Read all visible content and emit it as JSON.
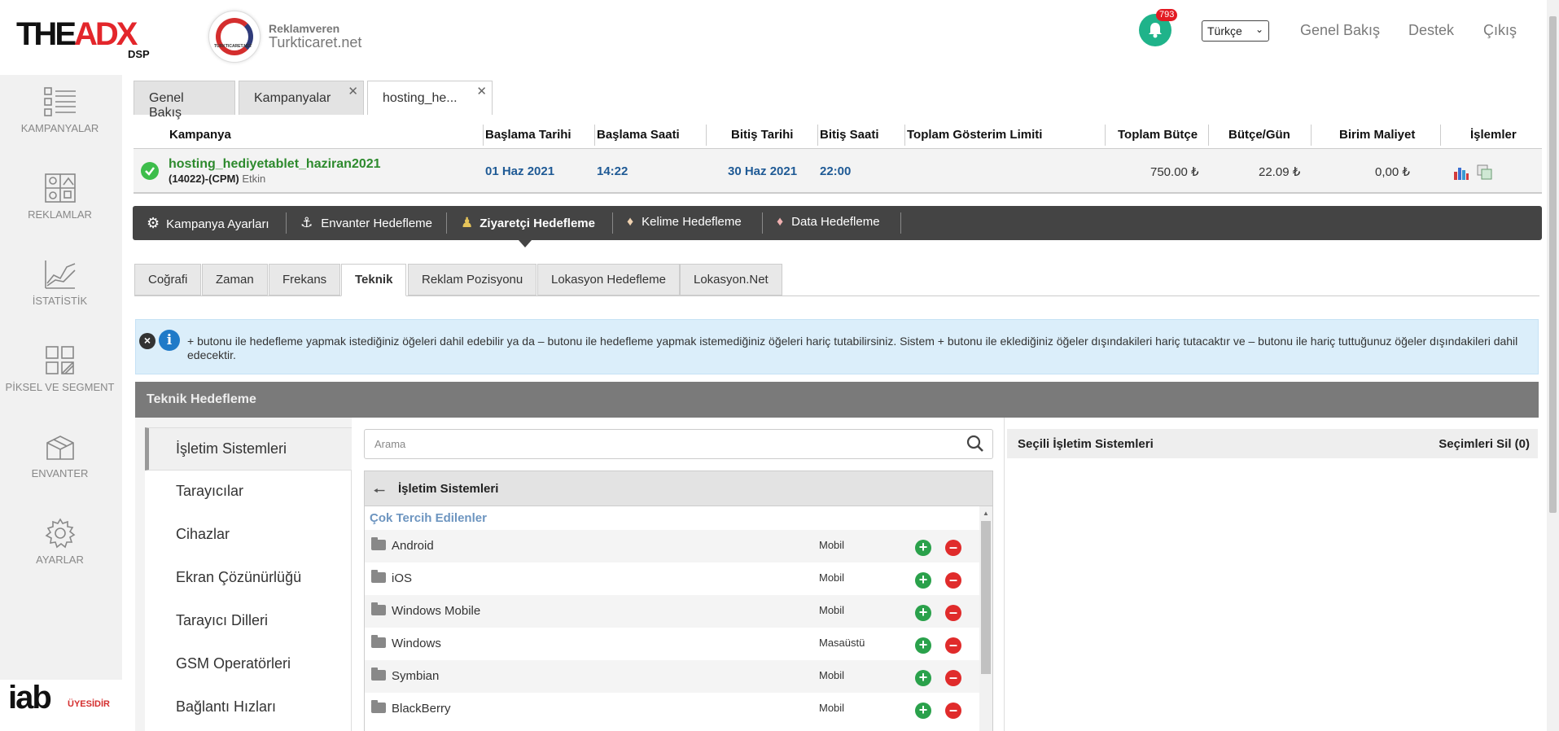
{
  "header": {
    "logo_main": "THE",
    "logo_accent": "ADX",
    "logo_sub": "DSP",
    "advertiser_logo_text": "TURKTICARET.NET",
    "advertiser_label": "Reklamveren",
    "advertiser_name": "Turkticaret.net",
    "notification_count": "793",
    "language": "Türkçe",
    "links": [
      "Genel Bakış",
      "Destek",
      "Çıkış"
    ]
  },
  "sidebar": {
    "items": [
      {
        "label": "KAMPANYALAR",
        "icon": "campaign-list-icon"
      },
      {
        "label": "REKLAMLAR",
        "icon": "ads-icon"
      },
      {
        "label": "İSTATİSTİK",
        "icon": "chart-icon"
      },
      {
        "label": "PİKSEL VE SEGMENT",
        "icon": "segment-icon"
      },
      {
        "label": "ENVANTER",
        "icon": "inventory-box-icon"
      },
      {
        "label": "AYARLAR",
        "icon": "gear-icon"
      }
    ],
    "iab_text": "iab",
    "iab_badge": "ÜYESİDİR"
  },
  "top_tabs": [
    {
      "label": "Genel Bakış",
      "closable": false
    },
    {
      "label": "Kampanyalar",
      "closable": true
    },
    {
      "label": "hosting_he...",
      "closable": true,
      "active": true
    }
  ],
  "campaign_table": {
    "headers": [
      "Kampanya",
      "Başlama Tarihi",
      "Başlama Saati",
      "Bitiş Tarihi",
      "Bitiş Saati",
      "Toplam Gösterim Limiti",
      "Toplam Bütçe",
      "Bütçe/Gün",
      "Birim Maliyet",
      "İşlemler"
    ],
    "row": {
      "name": "hosting_hediyetablet_haziran2021",
      "id_type": "(14022)-(CPM)",
      "status": "Etkin",
      "start_date": "01 Haz 2021",
      "start_time": "14:22",
      "end_date": "30 Haz 2021",
      "end_time": "22:00",
      "impression_limit": "",
      "total_budget": "750.00 ₺",
      "daily_budget": "22.09 ₺",
      "unit_cost": "0,00 ₺"
    }
  },
  "targeting_nav": [
    {
      "label": "Kampanya Ayarları",
      "icon": "gear-icon"
    },
    {
      "label": "Envanter Hedefleme",
      "icon": "anchor-icon"
    },
    {
      "label": "Ziyaretçi Hedefleme",
      "icon": "visitor-icon",
      "active": true
    },
    {
      "label": "Kelime Hedefleme",
      "icon": "tag-icon"
    },
    {
      "label": "Data Hedefleme",
      "icon": "tag-icon"
    }
  ],
  "sub_tabs": [
    {
      "label": "Coğrafi"
    },
    {
      "label": "Zaman"
    },
    {
      "label": "Frekans"
    },
    {
      "label": "Teknik",
      "active": true
    },
    {
      "label": "Reklam Pozisyonu"
    },
    {
      "label": "Lokasyon Hedefleme"
    },
    {
      "label": "Lokasyon.Net"
    }
  ],
  "info_text": "+ butonu ile hedefleme yapmak istediğiniz öğeleri dahil edebilir ya da – butonu ile hedefleme yapmak istemediğiniz öğeleri hariç tutabilirsiniz. Sistem + butonu ile eklediğiniz öğeler dışındakileri hariç tutacaktır ve – butonu ile hariç tuttuğunuz öğeler dışındakileri dahil edecektir.",
  "section_title": "Teknik Hedefleme",
  "categories": [
    "İşletim Sistemleri",
    "Tarayıcılar",
    "Cihazlar",
    "Ekran Çözünürlüğü",
    "Tarayıcı Dilleri",
    "GSM Operatörleri",
    "Bağlantı Hızları"
  ],
  "search": {
    "placeholder": "Arama"
  },
  "list": {
    "title": "İşletim Sistemleri",
    "group_label": "Çok Tercih Edilenler",
    "items": [
      {
        "name": "Android",
        "type": "Mobil"
      },
      {
        "name": "iOS",
        "type": "Mobil"
      },
      {
        "name": "Windows Mobile",
        "type": "Mobil"
      },
      {
        "name": "Windows",
        "type": "Masaüstü"
      },
      {
        "name": "Symbian",
        "type": "Mobil"
      },
      {
        "name": "BlackBerry",
        "type": "Mobil"
      }
    ]
  },
  "selected_panel": {
    "title": "Seçili İşletim Sistemleri",
    "clear_label": "Seçimleri Sil (0)"
  }
}
